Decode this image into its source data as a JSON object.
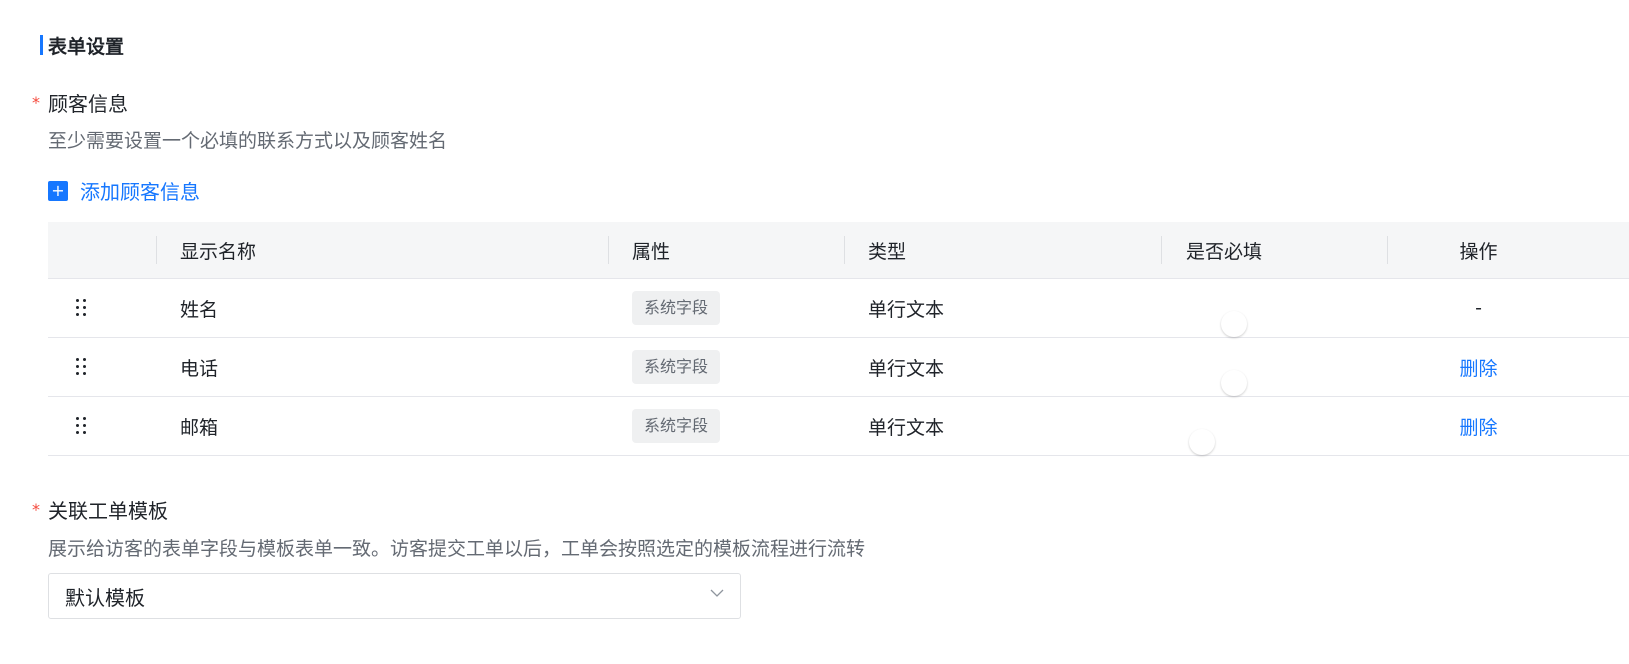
{
  "section": {
    "title": "表单设置"
  },
  "customer_info": {
    "required_mark": "*",
    "label": "顾客信息",
    "hint": "至少需要设置一个必填的联系方式以及顾客姓名",
    "add_icon": "+",
    "add_label": "添加顾客信息"
  },
  "table": {
    "headers": {
      "name": "显示名称",
      "attr": "属性",
      "type": "类型",
      "required": "是否必填",
      "ops": "操作"
    },
    "rows": [
      {
        "name": "姓名",
        "attr": "系统字段",
        "type": "单行文本",
        "required": true,
        "required_disabled": true,
        "op": "-"
      },
      {
        "name": "电话",
        "attr": "系统字段",
        "type": "单行文本",
        "required": true,
        "required_disabled": false,
        "op": "删除"
      },
      {
        "name": "邮箱",
        "attr": "系统字段",
        "type": "单行文本",
        "required": false,
        "required_disabled": false,
        "op": "删除"
      }
    ]
  },
  "ticket_template": {
    "required_mark": "*",
    "label": "关联工单模板",
    "hint": "展示给访客的表单字段与模板表单一致。访客提交工单以后，工单会按照选定的模板流程进行流转",
    "selected": "默认模板",
    "chevron_icon": "chevron-down-icon"
  },
  "colors": {
    "accent": "#1677ff",
    "required": "#f5483b",
    "muted": "#646a73"
  }
}
